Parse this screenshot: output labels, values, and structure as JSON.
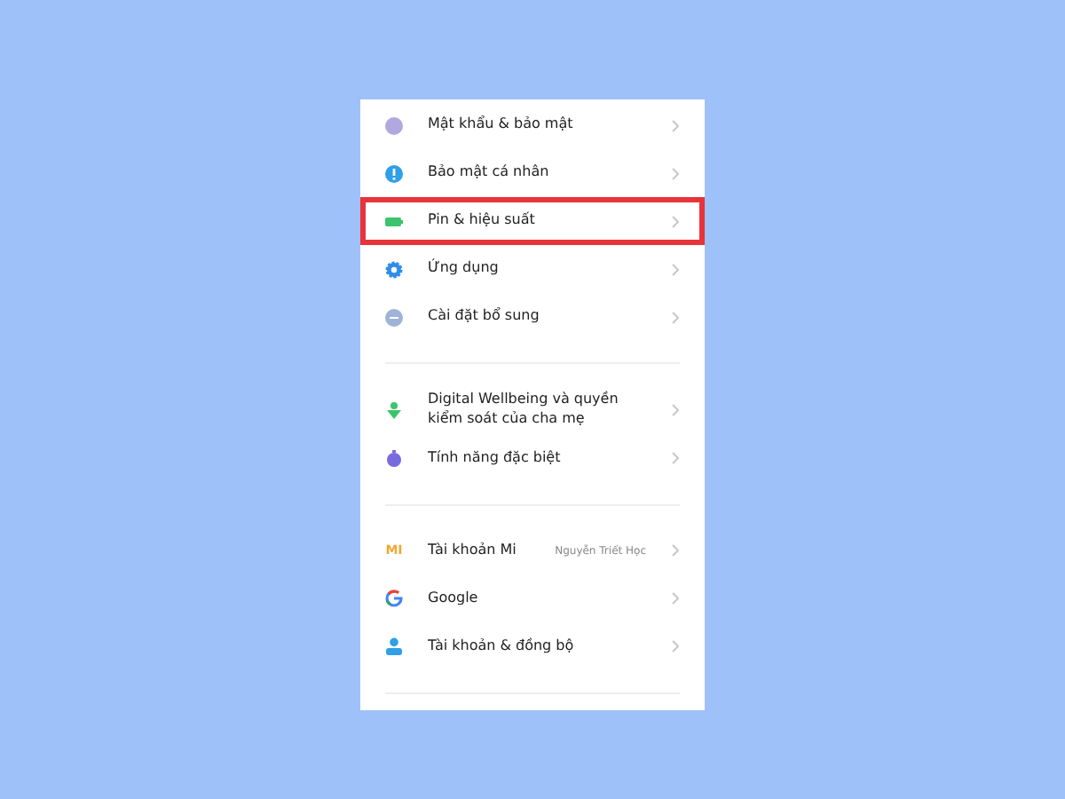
{
  "settings_groups": [
    {
      "items": [
        {
          "kind": "lock",
          "label": "Mật khẩu & bảo mật",
          "highlighted": false
        },
        {
          "kind": "shield",
          "label": "Bảo mật cá nhân",
          "highlighted": false
        },
        {
          "kind": "battery",
          "label": "Pin & hiệu suất",
          "highlighted": true
        },
        {
          "kind": "gear",
          "label": "Ứng dụng",
          "highlighted": false
        },
        {
          "kind": "more",
          "label": "Cài đặt bổ sung",
          "highlighted": false
        }
      ]
    },
    {
      "items": [
        {
          "kind": "wellbeing",
          "label": "Digital Wellbeing và quyền kiểm soát của cha mẹ",
          "highlighted": false
        },
        {
          "kind": "special",
          "label": "Tính năng đặc biệt",
          "highlighted": false
        }
      ]
    },
    {
      "items": [
        {
          "kind": "mi",
          "icon_text": "MI",
          "label": "Tài khoản Mi",
          "value": "Nguyễn Triết Học",
          "highlighted": false
        },
        {
          "kind": "google",
          "label": "Google",
          "highlighted": false
        },
        {
          "kind": "account",
          "label": "Tài khoản & đồng bộ",
          "highlighted": false
        }
      ]
    }
  ]
}
